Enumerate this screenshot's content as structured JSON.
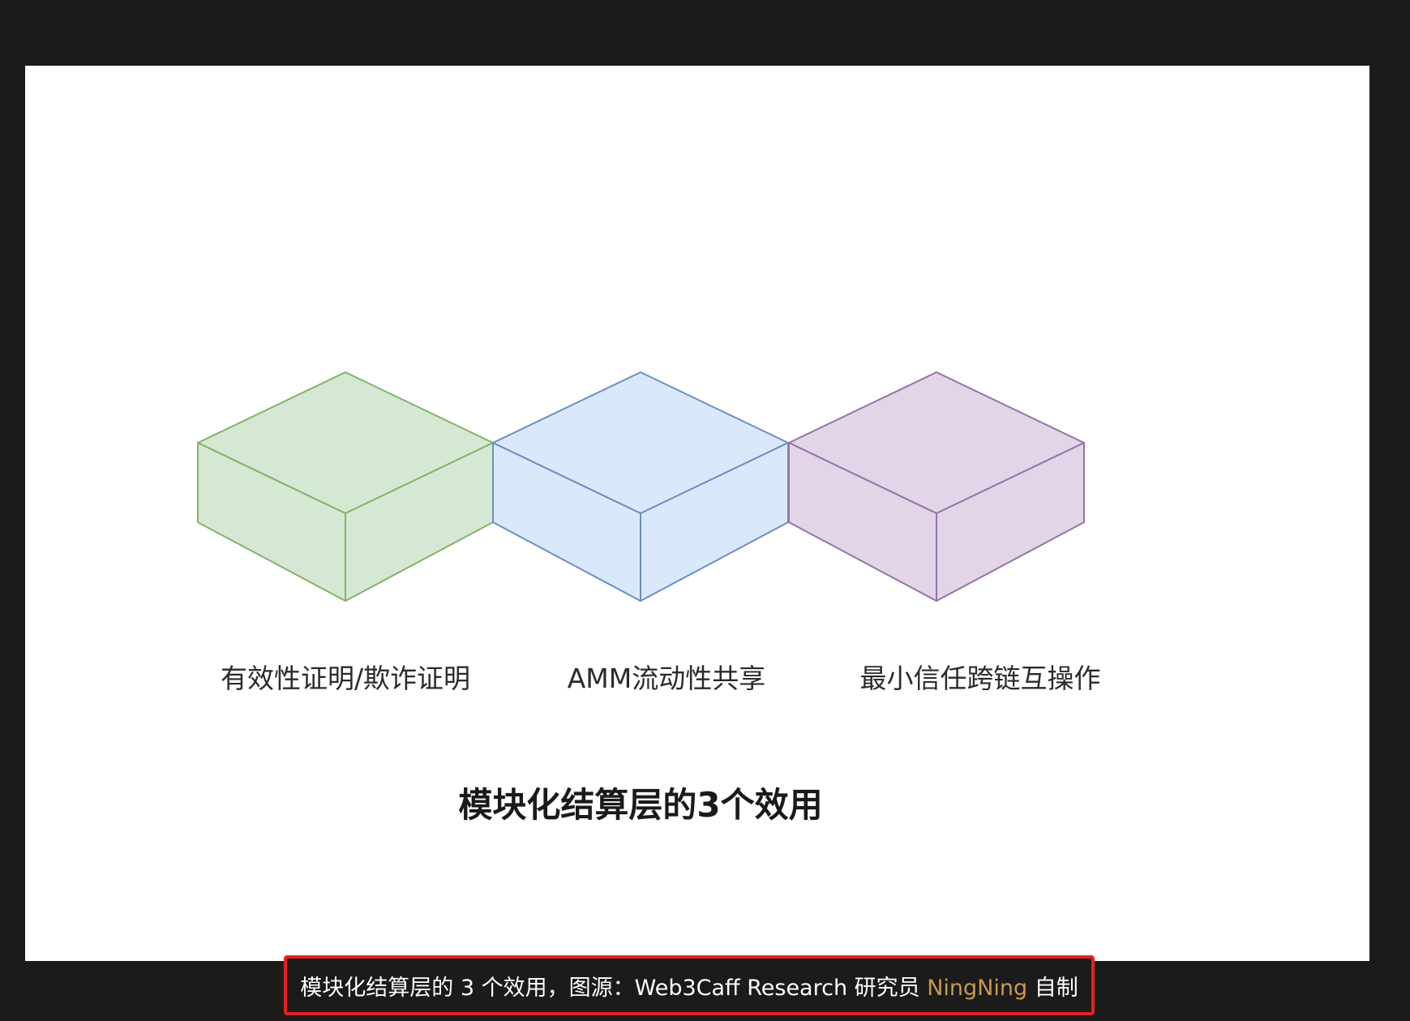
{
  "colors": {
    "background": "#1b1b1b",
    "canvas": "#ffffff",
    "caption_border": "#e8201f",
    "caption_author": "#c99a4c",
    "cube_green_fill": "#d5e8d4",
    "cube_green_stroke": "#82b366",
    "cube_blue_fill": "#dae8fc",
    "cube_blue_stroke": "#6c8ebf",
    "cube_purple_fill": "#e1d5e7",
    "cube_purple_stroke": "#9673a6"
  },
  "diagram": {
    "cubes": [
      {
        "label": "有效性证明/欺诈证明",
        "color": "green"
      },
      {
        "label": "AMM流动性共享",
        "color": "blue"
      },
      {
        "label": "最小信任跨链互操作",
        "color": "purple"
      }
    ],
    "title": "模块化结算层的3个效用"
  },
  "caption": {
    "prefix": "模块化结算层的 3 个效用，图源：Web3Caff Research 研究员 ",
    "author": "NingNing",
    "suffix": " 自制"
  }
}
